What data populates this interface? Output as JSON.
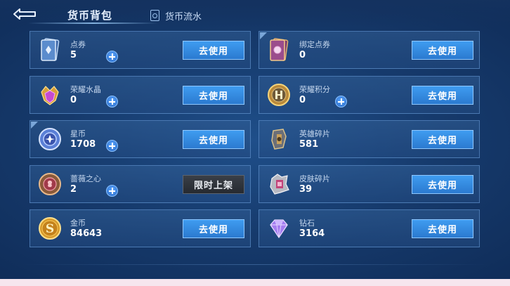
{
  "header": {
    "title": "货币背包",
    "flow_label": "货币流水"
  },
  "currencies": [
    {
      "name": "点券",
      "count": "5",
      "action": "去使用",
      "icon": "coupon-card-icon"
    },
    {
      "name": "绑定点券",
      "count": "0",
      "action": "去使用",
      "icon": "bound-coupon-card-icon"
    },
    {
      "name": "荣耀水晶",
      "count": "0",
      "action": "去使用",
      "icon": "glory-crystal-icon"
    },
    {
      "name": "荣耀积分",
      "count": "0",
      "action": "去使用",
      "icon": "glory-points-icon"
    },
    {
      "name": "星币",
      "count": "1708",
      "action": "去使用",
      "icon": "star-coin-icon"
    },
    {
      "name": "英雄碎片",
      "count": "581",
      "action": "去使用",
      "icon": "hero-fragment-icon"
    },
    {
      "name": "蔷薇之心",
      "count": "2",
      "action": "限时上架",
      "icon": "rose-heart-icon"
    },
    {
      "name": "皮肤碎片",
      "count": "39",
      "action": "去使用",
      "icon": "skin-fragment-icon"
    },
    {
      "name": "金币",
      "count": "84643",
      "action": "去使用",
      "icon": "gold-coin-icon"
    },
    {
      "name": "钻石",
      "count": "3164",
      "action": "去使用",
      "icon": "diamond-icon"
    }
  ],
  "colors": {
    "accent": "#3f9cf0",
    "background": "#163a6c",
    "card_border": "#6ea0dc",
    "limited_button": "#2f343b"
  }
}
